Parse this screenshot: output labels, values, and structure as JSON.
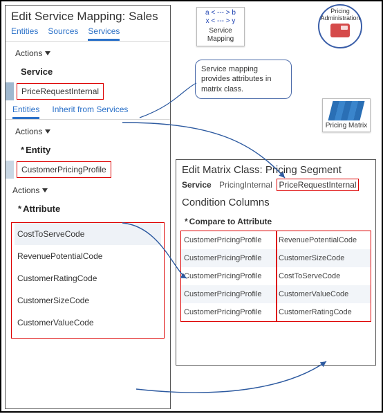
{
  "left": {
    "title": "Edit Service Mapping: Sales",
    "tabs": [
      "Entities",
      "Sources",
      "Services"
    ],
    "activeTab": 2,
    "actions": "Actions",
    "serviceHead": "Service",
    "serviceValue": "PriceRequestInternal",
    "subtabs": [
      "Entities",
      "Inherit from Services"
    ],
    "activeSubtab": 0,
    "entityHead": "Entity",
    "entityValue": "CustomerPricingProfile",
    "attributeHead": "Attribute",
    "attributes": [
      "CostToServeCode",
      "RevenuePotentialCode",
      "CustomerRatingCode",
      "CustomerSizeCode",
      "CustomerValueCode"
    ]
  },
  "svcMap": {
    "line1": "a < --- > b",
    "line2": "x < --- > y",
    "label": "Service Mapping"
  },
  "pricingAdmin": {
    "line1": "Pricing",
    "line2": "Administration"
  },
  "callout": "Service mapping provides attributes in matrix class.",
  "matrix": {
    "label": "Pricing Matrix"
  },
  "right": {
    "title": "Edit Matrix Class: Pricing Segment",
    "svcLabel": "Service",
    "svc1": "PricingInternal",
    "svc2": "PriceRequestInternal",
    "condHead": "Condition Columns",
    "compareHead": "Compare to Attribute",
    "rows": [
      {
        "a": "CustomerPricingProfile",
        "b": "RevenuePotentialCode"
      },
      {
        "a": "CustomerPricingProfile",
        "b": "CustomerSizeCode"
      },
      {
        "a": "CustomerPricingProfile",
        "b": "CostToServeCode"
      },
      {
        "a": "CustomerPricingProfile",
        "b": "CustomerValueCode"
      },
      {
        "a": "CustomerPricingProfile",
        "b": "CustomerRatingCode"
      }
    ]
  }
}
